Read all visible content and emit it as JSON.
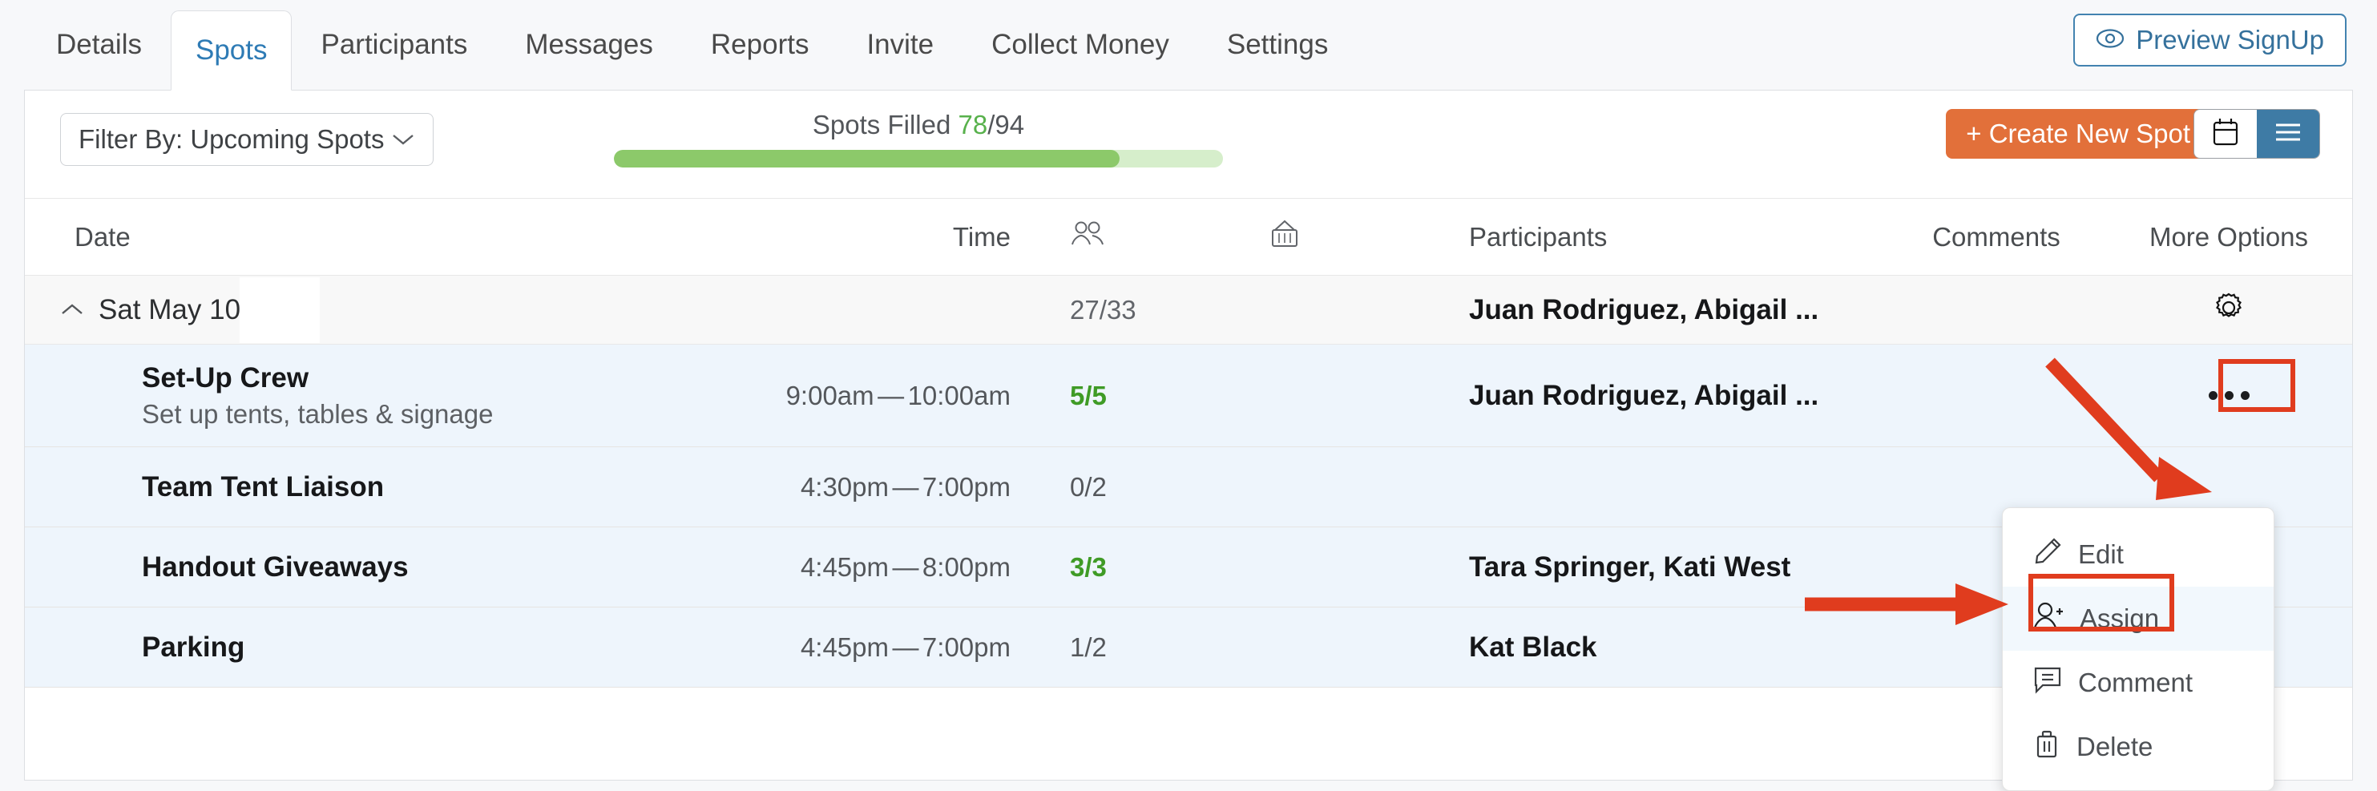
{
  "header": {
    "tabs": [
      {
        "label": "Details",
        "active": false
      },
      {
        "label": "Spots",
        "active": true
      },
      {
        "label": "Participants",
        "active": false
      },
      {
        "label": "Messages",
        "active": false
      },
      {
        "label": "Reports",
        "active": false
      },
      {
        "label": "Invite",
        "active": false
      },
      {
        "label": "Collect Money",
        "active": false
      },
      {
        "label": "Settings",
        "active": false
      }
    ],
    "preview_button": "Preview SignUp",
    "preview_icon": "eye-icon",
    "accent_blue": "#2e7bb5"
  },
  "toolbar": {
    "filter_value": "Filter By: Upcoming Spots",
    "filter_chevron": "chevron-down-icon",
    "spots_filled_label": "Spots Filled",
    "spots_filled_count": "78",
    "spots_filled_total": "/94",
    "progress_percent": 83,
    "progress_fill_color": "#8cc96a",
    "progress_track_color": "#d6eecb",
    "create_button": "+ Create New Spot",
    "create_button_color": "#e2703a",
    "view_calendar_icon": "calendar-icon",
    "view_list_icon": "list-icon",
    "view_selected": "list"
  },
  "table": {
    "headers": {
      "date": "Date",
      "time": "Time",
      "people_icon": "people-icon",
      "gift_icon": "gift-basket-icon",
      "participants": "Participants",
      "comments": "Comments",
      "more_options": "More Options"
    },
    "group": {
      "caret": "chevron-up-icon",
      "date": "Sat May 10",
      "redacted": true,
      "count": "27/33",
      "participants": "Juan Rodriguez, Abigail ...",
      "gear_icon": "gear-icon"
    },
    "rows": [
      {
        "title": "Set-Up Crew",
        "subtitle": "Set up tents, tables & signage",
        "start": "9:00am",
        "dash": "—",
        "end": "10:00am",
        "count": "5/5",
        "count_full": true,
        "participants": "Juan Rodriguez, Abigail ...",
        "more_icon": "ellipsis-icon"
      },
      {
        "title": "Team Tent Liaison",
        "subtitle": "",
        "start": "4:30pm",
        "dash": "—",
        "end": "7:00pm",
        "count": "0/2",
        "count_full": false,
        "participants": "",
        "more_icon": "ellipsis-icon"
      },
      {
        "title": "Handout Giveaways",
        "subtitle": "",
        "start": "4:45pm",
        "dash": "—",
        "end": "8:00pm",
        "count": "3/3",
        "count_full": true,
        "participants": "Tara Springer, Kati West",
        "more_icon": "ellipsis-icon"
      },
      {
        "title": "Parking",
        "subtitle": "",
        "start": "4:45pm",
        "dash": "—",
        "end": "7:00pm",
        "count": "1/2",
        "count_full": false,
        "participants": "Kat Black",
        "more_icon": "ellipsis-icon"
      }
    ]
  },
  "context_menu": {
    "items": [
      {
        "label": "Edit",
        "icon": "pencil-icon",
        "highlighted": false
      },
      {
        "label": "Assign",
        "icon": "person-add-icon",
        "highlighted": true
      },
      {
        "label": "Comment",
        "icon": "comment-icon",
        "highlighted": false
      },
      {
        "label": "Delete",
        "icon": "trash-icon",
        "highlighted": false
      }
    ]
  },
  "annotations": {
    "highlight_color": "#e03c1e",
    "arrow_1_target": "ellipsis-icon",
    "arrow_2_target": "assign-menu-item"
  }
}
